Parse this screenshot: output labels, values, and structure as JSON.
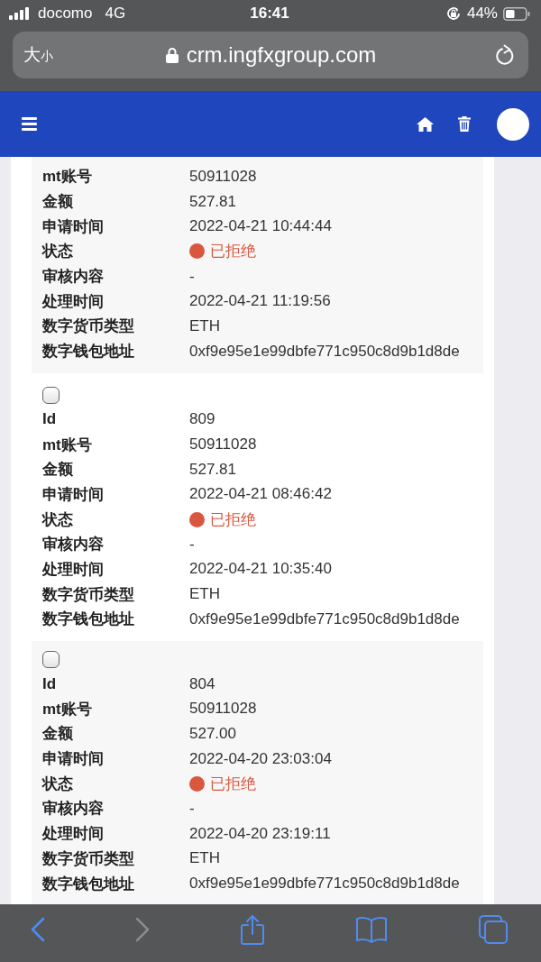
{
  "status_bar": {
    "carrier": "docomo",
    "network": "4G",
    "time": "16:41",
    "battery": "44%"
  },
  "browser": {
    "text_size": "大小",
    "url": "crm.ingfxgroup.com"
  },
  "records": [
    {
      "fields": [
        {
          "label": "mt账号",
          "value": "50911028"
        },
        {
          "label": "金额",
          "value": "527.81"
        },
        {
          "label": "申请时间",
          "value": "2022-04-21 10:44:44"
        },
        {
          "label": "状态",
          "value": "已拒绝",
          "kind": "status",
          "color": "#d9573f"
        },
        {
          "label": "审核内容",
          "value": "-"
        },
        {
          "label": "处理时间",
          "value": "2022-04-21 11:19:56"
        },
        {
          "label": "数字货币类型",
          "value": "ETH"
        },
        {
          "label": "数字钱包地址",
          "value": "0xf9e95e1e99dbfe771c950c8d9b1d8de"
        }
      ]
    },
    {
      "checked": false,
      "fields": [
        {
          "label": "Id",
          "value": "809"
        },
        {
          "label": "mt账号",
          "value": "50911028"
        },
        {
          "label": "金额",
          "value": "527.81"
        },
        {
          "label": "申请时间",
          "value": "2022-04-21 08:46:42"
        },
        {
          "label": "状态",
          "value": "已拒绝",
          "kind": "status",
          "color": "#d9573f"
        },
        {
          "label": "审核内容",
          "value": "-"
        },
        {
          "label": "处理时间",
          "value": "2022-04-21 10:35:40"
        },
        {
          "label": "数字货币类型",
          "value": "ETH"
        },
        {
          "label": "数字钱包地址",
          "value": "0xf9e95e1e99dbfe771c950c8d9b1d8de"
        }
      ]
    },
    {
      "checked": false,
      "fields": [
        {
          "label": "Id",
          "value": "804"
        },
        {
          "label": "mt账号",
          "value": "50911028"
        },
        {
          "label": "金额",
          "value": "527.00"
        },
        {
          "label": "申请时间",
          "value": "2022-04-20 23:03:04"
        },
        {
          "label": "状态",
          "value": "已拒绝",
          "kind": "status",
          "color": "#d9573f"
        },
        {
          "label": "审核内容",
          "value": "-"
        },
        {
          "label": "处理时间",
          "value": "2022-04-20 23:19:11"
        },
        {
          "label": "数字货币类型",
          "value": "ETH"
        },
        {
          "label": "数字钱包地址",
          "value": "0xf9e95e1e99dbfe771c950c8d9b1d8de"
        }
      ]
    }
  ],
  "toolbar": {
    "back_enabled": true,
    "forward_enabled": false
  }
}
